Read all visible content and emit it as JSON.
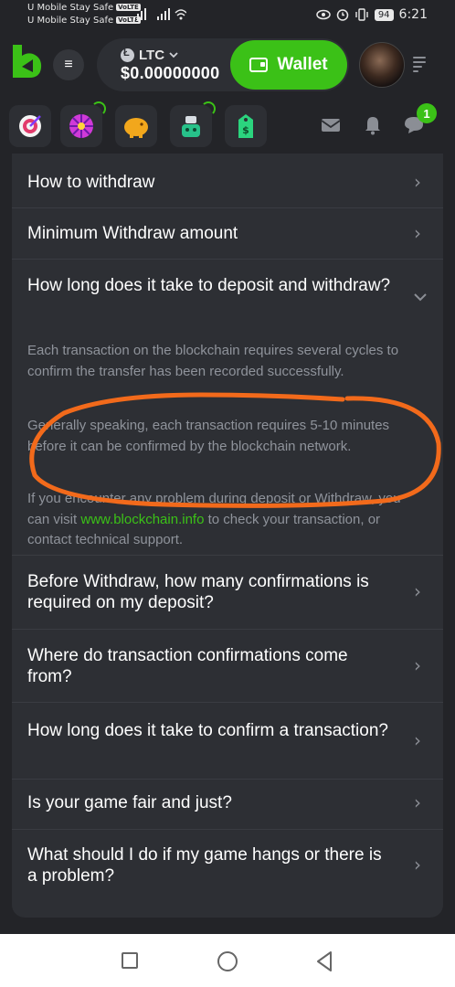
{
  "status_bar": {
    "carrier_1": "U Mobile Stay Safe",
    "carrier_2": "U Mobile Stay Safe",
    "volte_label": "VoLTE",
    "signal_icons": "..ıl ..ıl ⌔",
    "right_icons": "👁 ⏰ ▯",
    "battery": "94",
    "time": "6:21"
  },
  "header": {
    "currency": "LTC",
    "balance": "$0.00000000",
    "wallet_label": "Wallet",
    "menu_icon": "≡",
    "notification_count": "1"
  },
  "game_icons": [
    {
      "name": "target-game-icon",
      "color": "#e23b6c"
    },
    {
      "name": "spin-wheel-icon",
      "color": "#d03ad8"
    },
    {
      "name": "piggy-bank-icon",
      "color": "#f2a71c"
    },
    {
      "name": "robot-icon",
      "color": "#27c28a"
    },
    {
      "name": "price-tag-icon",
      "color": "#2bd47e"
    }
  ],
  "faq": {
    "q1": "How to withdraw",
    "q2": "Minimum Withdraw amount",
    "q3": "How long does it take to deposit and withdraw?",
    "a3_p1": "Each transaction on the blockchain requires several cycles to confirm the transfer has been recorded successfully.",
    "a3_p2": "Generally speaking, each transaction requires 5-10 minutes before it can be confirmed by the blockchain network.",
    "a3_p3_before": "If you encounter any problem during deposit or Withdraw, you can visit ",
    "a3_p3_link": "www.blockchain.info",
    "a3_p3_after": " to check your transaction, or contact technical support.",
    "q4": "Before Withdraw, how many confirmations is required on my deposit?",
    "q5": "Where do transaction confirmations come from?",
    "q6": "How long does it take to confirm a transaction?",
    "q7": "Is your game fair and just?",
    "q8": "What should I do if my game hangs or there is a problem?"
  },
  "colors": {
    "accent": "#3bc117",
    "background": "#232428",
    "card": "#2d2f34",
    "annotation": "#f26a1b"
  }
}
